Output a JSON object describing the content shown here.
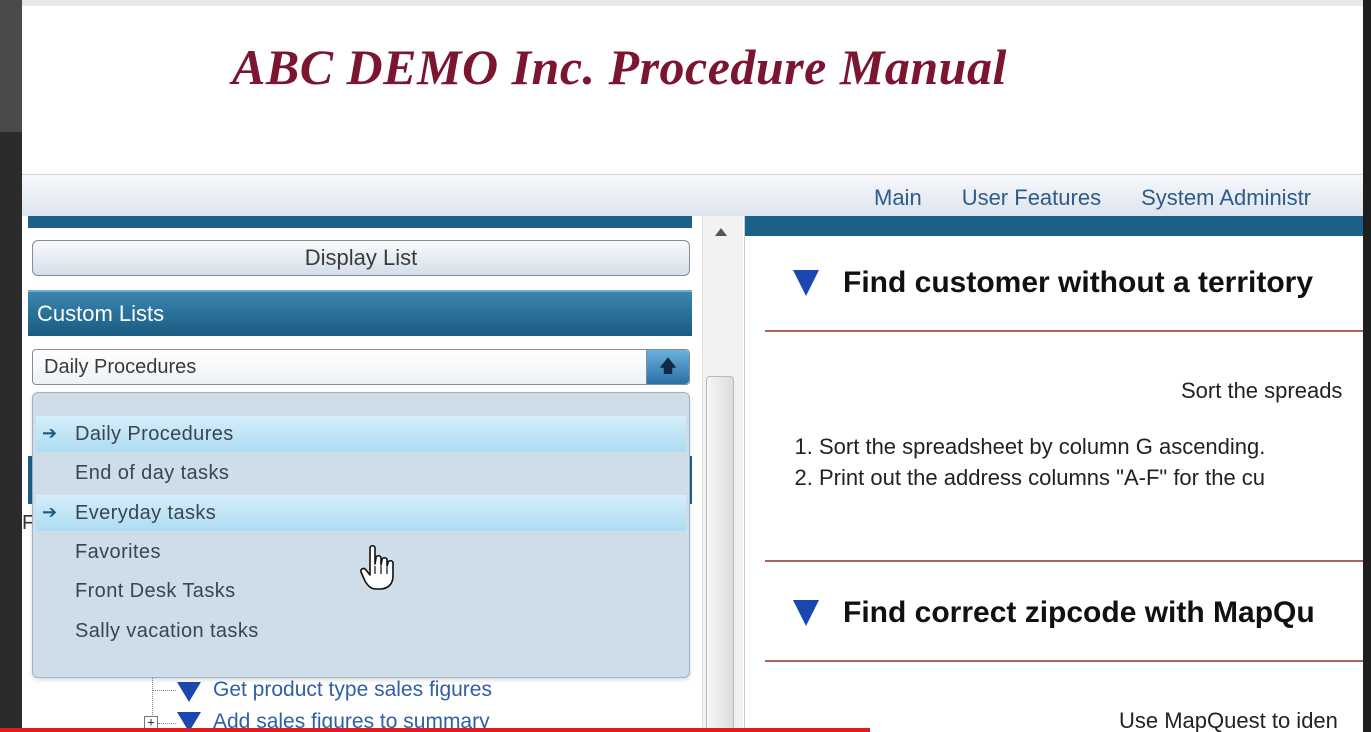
{
  "header": {
    "title": "ABC DEMO Inc.  Procedure Manual"
  },
  "nav": {
    "items": [
      "Main",
      "User Features",
      "System Administr"
    ]
  },
  "left": {
    "display_list_label": "Display List",
    "custom_lists_heading": "Custom Lists",
    "combo_value": "Daily Procedures",
    "dropdown_items": [
      {
        "label": "Daily Procedures",
        "selected": true
      },
      {
        "label": "End of day tasks",
        "selected": false
      },
      {
        "label": "Everyday tasks",
        "selected": true
      },
      {
        "label": "Favorites",
        "selected": false
      },
      {
        "label": "Front Desk Tasks",
        "selected": false
      },
      {
        "label": "Sally vacation tasks",
        "selected": false
      }
    ],
    "partial_letter": "F",
    "tree": [
      "Get product type sales figures",
      "Add sales figures to summary"
    ]
  },
  "right": {
    "procedures": [
      {
        "title": "Find customer without a territory",
        "intro": "Sort the spreads",
        "steps": [
          "Sort the spreadsheet by column G ascending.",
          "Print out the address columns \"A-F\" for the cu"
        ]
      },
      {
        "title": "Find correct zipcode with MapQu",
        "intro": "Use MapQuest to iden"
      }
    ]
  },
  "colors": {
    "title": "#7b1530",
    "section_bar": "#1b6187",
    "nav_link": "#2d5b8a",
    "tree_link": "#2e5fa8",
    "dropdown_bg": "#cedde8"
  },
  "icons": [
    "arrow-up-icon",
    "arrow-right-icon",
    "triangle-down-icon",
    "hand-cursor-icon",
    "plus-box-icon"
  ]
}
